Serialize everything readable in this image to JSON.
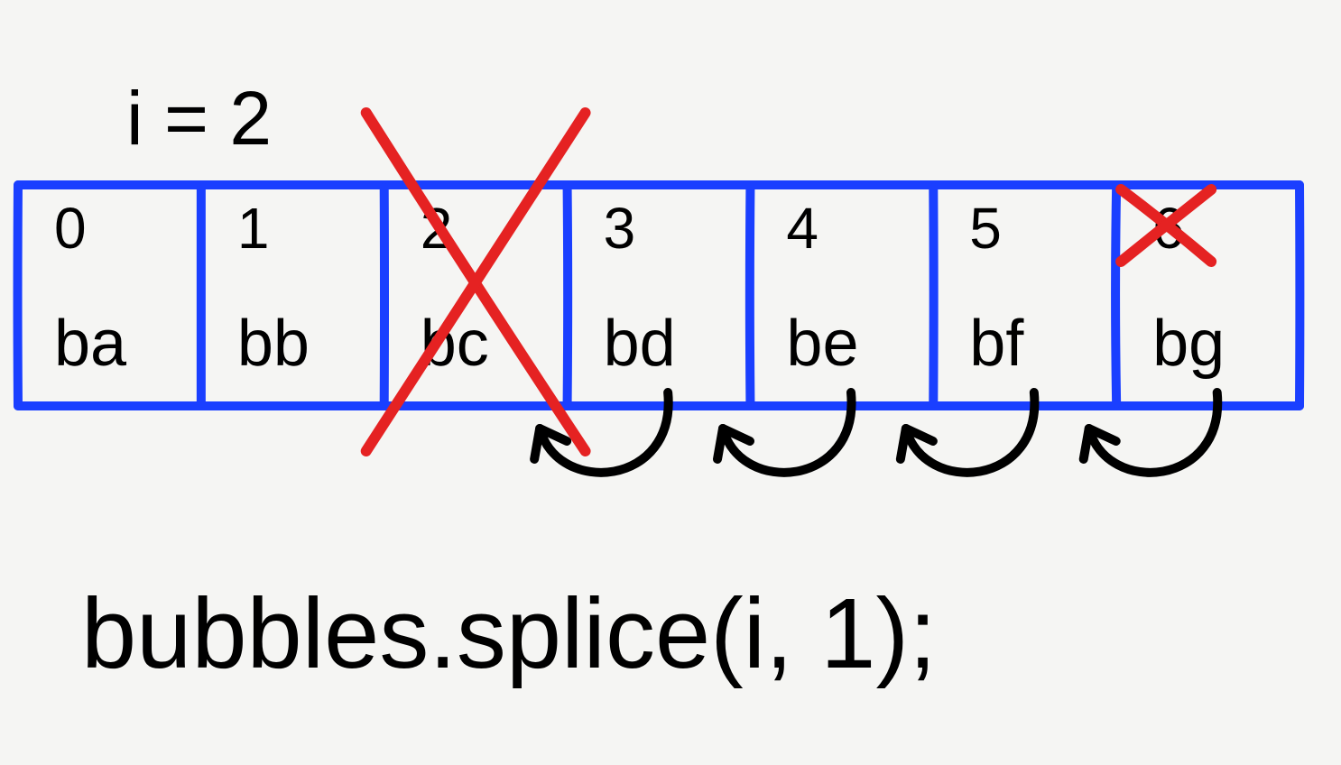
{
  "variable_assignment": "i = 2",
  "cells": [
    {
      "index": "0",
      "value": "ba",
      "crossed": false,
      "index_crossed": false
    },
    {
      "index": "1",
      "value": "bb",
      "crossed": false,
      "index_crossed": false
    },
    {
      "index": "2",
      "value": "bc",
      "crossed": true,
      "index_crossed": false
    },
    {
      "index": "3",
      "value": "bd",
      "crossed": false,
      "index_crossed": false
    },
    {
      "index": "4",
      "value": "be",
      "crossed": false,
      "index_crossed": false
    },
    {
      "index": "5",
      "value": "bf",
      "crossed": false,
      "index_crossed": false
    },
    {
      "index": "6",
      "value": "bg",
      "crossed": false,
      "index_crossed": true
    }
  ],
  "shift_arrows_from": [
    3,
    4,
    5,
    6
  ],
  "code_line": "bubbles.splice(i, 1);",
  "colors": {
    "border": "#1a3fff",
    "cross": "#e52222",
    "ink": "#000000",
    "bg": "#f5f5f3"
  }
}
